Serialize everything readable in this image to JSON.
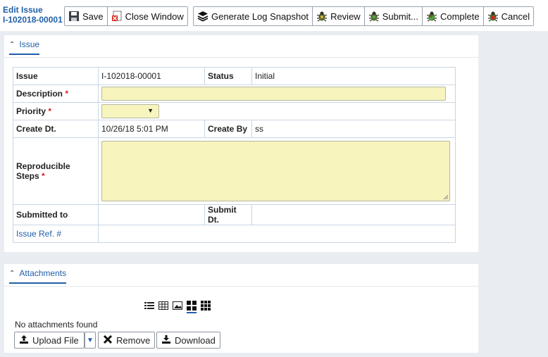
{
  "header": {
    "edit_label": "Edit Issue",
    "issue_number": "I-102018-00001"
  },
  "toolbar": {
    "save": "Save",
    "close_window": "Close Window",
    "generate_log": "Generate Log Snapshot",
    "review": "Review",
    "submit": "Submit...",
    "complete": "Complete",
    "cancel": "Cancel"
  },
  "issue_section": {
    "title": "Issue",
    "fields": {
      "issue_label": "Issue",
      "issue_value": "I-102018-00001",
      "status_label": "Status",
      "status_value": "Initial",
      "description_label": "Description",
      "description_value": "",
      "priority_label": "Priority",
      "priority_value": "",
      "create_dt_label": "Create Dt.",
      "create_dt_value": "10/26/18 5:01 PM",
      "create_by_label": "Create By",
      "create_by_value": "ss",
      "steps_label": "Reproducible Steps",
      "steps_value": "",
      "submitted_to_label": "Submitted to",
      "submitted_to_value": "",
      "submit_dt_label": "Submit Dt.",
      "submit_dt_value": "",
      "issue_ref_label": "Issue Ref. #",
      "issue_ref_value": ""
    },
    "required_mark": "*"
  },
  "attachments_section": {
    "title": "Attachments",
    "empty_text": "No attachments found",
    "upload": "Upload File",
    "remove": "Remove",
    "download": "Download"
  },
  "colors": {
    "accent": "#1f5fa8",
    "required": "#d9201f",
    "input_fill": "#f7f4be"
  }
}
